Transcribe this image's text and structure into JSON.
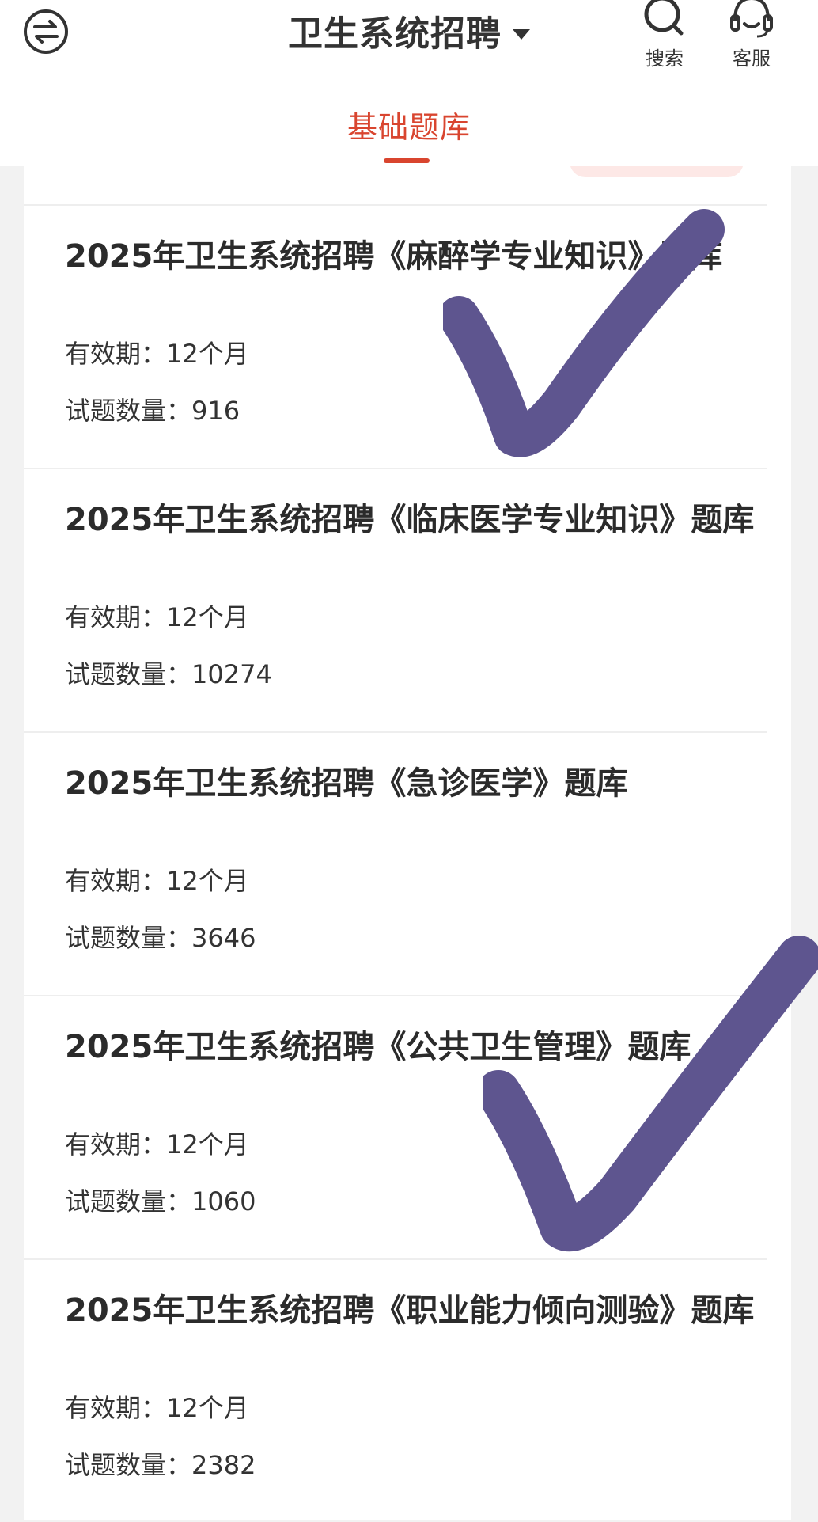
{
  "header": {
    "title": "卫生系统招聘",
    "search_label": "搜索",
    "service_label": "客服"
  },
  "tabs": {
    "active": "基础题库"
  },
  "items": [
    {
      "title": "2025年卫生系统招聘《麻醉学专业知识》题库",
      "validity_label": "有效期：",
      "validity_value": "12个月",
      "count_label": "试题数量：",
      "count_value": "916"
    },
    {
      "title": "2025年卫生系统招聘《临床医学专业知识》题库",
      "validity_label": "有效期：",
      "validity_value": "12个月",
      "count_label": "试题数量：",
      "count_value": "10274"
    },
    {
      "title": "2025年卫生系统招聘《急诊医学》题库",
      "validity_label": "有效期：",
      "validity_value": "12个月",
      "count_label": "试题数量：",
      "count_value": "3646"
    },
    {
      "title": "2025年卫生系统招聘《公共卫生管理》题库",
      "validity_label": "有效期：",
      "validity_value": "12个月",
      "count_label": "试题数量：",
      "count_value": "1060"
    },
    {
      "title": "2025年卫生系统招聘《职业能力倾向测验》题库",
      "validity_label": "有效期：",
      "validity_value": "12个月",
      "count_label": "试题数量：",
      "count_value": "2382"
    }
  ],
  "colors": {
    "accent": "#d9452f",
    "checkmark": "#5e558f"
  },
  "icons": [
    "menu-switch-icon",
    "dropdown-caret-icon",
    "search-icon",
    "headset-icon",
    "checkmark-icon"
  ]
}
